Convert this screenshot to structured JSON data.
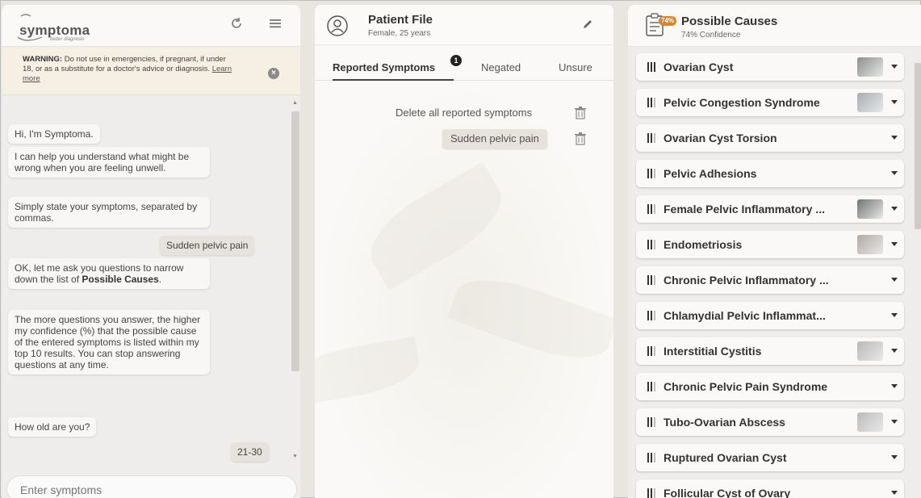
{
  "app": {
    "logo_text": "symptoma",
    "logo_tagline": "better diagnosis"
  },
  "chat": {
    "header_icons": [
      "reset-icon",
      "menu-icon"
    ],
    "warning": {
      "label": "WARNING:",
      "text": " Do not use in emergencies, if pregnant, if under 18, or as a substitute for a doctor's advice or diagnosis. ",
      "link": "Learn more"
    },
    "messages": [
      {
        "from": "bot",
        "text": "Hi, I'm Symptoma."
      },
      {
        "from": "bot",
        "text": "I can help you understand what might be wrong when you are feeling unwell."
      },
      {
        "from": "bot",
        "text": "Simply state your symptoms, separated by commas."
      },
      {
        "from": "user",
        "text": "Sudden pelvic pain"
      },
      {
        "from": "bot",
        "text_before": "OK, let me ask you questions to narrow down the list of ",
        "bold": "Possible Causes",
        "text_after": "."
      },
      {
        "from": "bot",
        "text": "The more questions you answer, the higher my confidence (%) that the possible cause of the entered symptoms is listed within my top 10 results. You can stop answering questions at any time."
      },
      {
        "from": "bot",
        "text": "How old are you?"
      },
      {
        "from": "user",
        "text": "21-30"
      }
    ],
    "input_placeholder": "Enter symptoms"
  },
  "patient_file": {
    "title": "Patient File",
    "subtitle": "Female, 25 years",
    "tabs": [
      {
        "label": "Reported Symptoms",
        "badge": "1",
        "active": true
      },
      {
        "label": "Negated",
        "active": false
      },
      {
        "label": "Unsure",
        "active": false
      }
    ],
    "delete_all_label": "Delete all reported symptoms",
    "symptoms": [
      "Sudden pelvic pain"
    ]
  },
  "possible_causes": {
    "title": "Possible Causes",
    "confidence_badge": "74%",
    "subtitle": "74% Confidence",
    "accent_color": "#d9852b",
    "items": [
      {
        "name": "Ovarian Cyst",
        "rank": 3,
        "thumb": true
      },
      {
        "name": "Pelvic Congestion Syndrome",
        "rank": 2,
        "thumb": true
      },
      {
        "name": "Ovarian Cyst Torsion",
        "rank": 2,
        "thumb": false
      },
      {
        "name": "Pelvic Adhesions",
        "rank": 2,
        "thumb": false
      },
      {
        "name": "Female Pelvic Inflammatory ...",
        "rank": 2,
        "thumb": true
      },
      {
        "name": "Endometriosis",
        "rank": 2,
        "thumb": true
      },
      {
        "name": "Chronic Pelvic Inflammatory ...",
        "rank": 2,
        "thumb": false
      },
      {
        "name": "Chlamydial Pelvic Inflammat...",
        "rank": 2,
        "thumb": false
      },
      {
        "name": "Interstitial Cystitis",
        "rank": 2,
        "thumb": true
      },
      {
        "name": "Chronic Pelvic Pain Syndrome",
        "rank": 2,
        "thumb": false
      },
      {
        "name": "Tubo-Ovarian Abscess",
        "rank": 2,
        "thumb": true
      },
      {
        "name": "Ruptured Ovarian Cyst",
        "rank": 2,
        "thumb": false
      },
      {
        "name": "Follicular Cyst of Ovary",
        "rank": 2,
        "thumb": false
      }
    ]
  }
}
